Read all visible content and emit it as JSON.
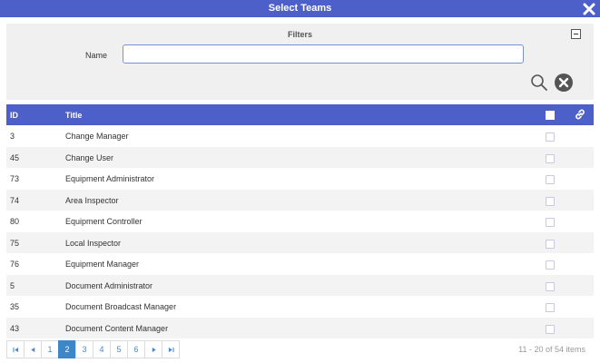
{
  "dialog": {
    "title": "Select Teams"
  },
  "filters": {
    "title": "Filters",
    "name_label": "Name",
    "name_value": ""
  },
  "grid": {
    "columns": {
      "id": "ID",
      "title": "Title"
    },
    "rows": [
      {
        "id": "3",
        "title": "Change Manager"
      },
      {
        "id": "45",
        "title": "Change User"
      },
      {
        "id": "73",
        "title": "Equipment Administrator"
      },
      {
        "id": "74",
        "title": "Area Inspector"
      },
      {
        "id": "80",
        "title": "Equipment Controller"
      },
      {
        "id": "75",
        "title": "Local Inspector"
      },
      {
        "id": "76",
        "title": "Equipment Manager"
      },
      {
        "id": "5",
        "title": "Document Administrator"
      },
      {
        "id": "35",
        "title": "Document Broadcast Manager"
      },
      {
        "id": "43",
        "title": "Document Content Manager"
      }
    ]
  },
  "pager": {
    "pages": [
      "1",
      "2",
      "3",
      "4",
      "5",
      "6"
    ],
    "current": "2",
    "info": "11 - 20 of 54 items"
  },
  "colors": {
    "header": "#4d5fc9",
    "active_page": "#3d87c9"
  }
}
